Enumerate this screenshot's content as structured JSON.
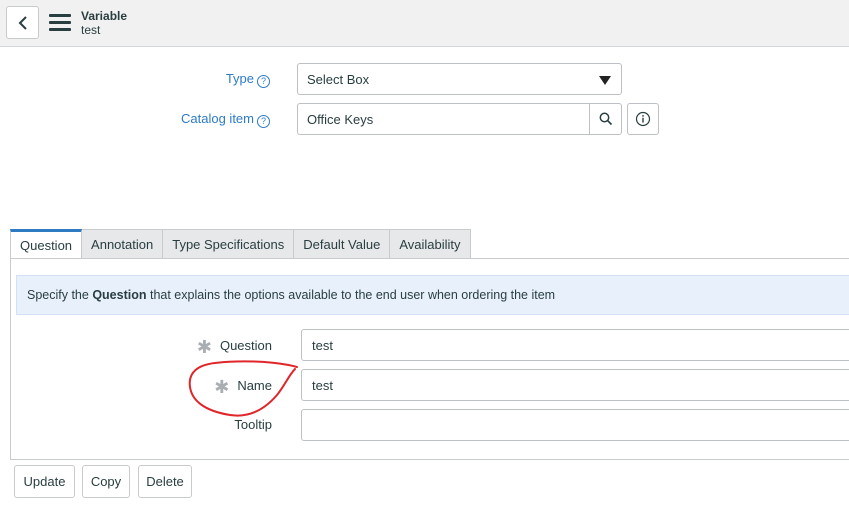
{
  "header": {
    "title": "Variable",
    "subtitle": "test"
  },
  "form": {
    "type": {
      "label": "Type",
      "value": "Select Box"
    },
    "catalog_item": {
      "label": "Catalog item",
      "value": "Office Keys"
    }
  },
  "tabs": [
    {
      "label": "Question",
      "active": true
    },
    {
      "label": "Annotation"
    },
    {
      "label": "Type Specifications"
    },
    {
      "label": "Default Value"
    },
    {
      "label": "Availability"
    }
  ],
  "info": {
    "prefix": "Specify the ",
    "bold": "Question",
    "suffix": " that explains the options available to the end user when ordering the item"
  },
  "fields": {
    "question": {
      "label": "Question",
      "value": "test",
      "mandatory": true
    },
    "name": {
      "label": "Name",
      "value": "test",
      "mandatory": true
    },
    "tooltip": {
      "label": "Tooltip",
      "value": ""
    }
  },
  "buttons": {
    "update": "Update",
    "copy": "Copy",
    "delete": "Delete"
  },
  "colors": {
    "link_blue": "#2e7bc4",
    "annotation_red": "#e0262a",
    "info_bg": "#e8f1fb"
  },
  "icons": [
    "back-icon",
    "hamburger-menu-icon",
    "help-icon",
    "dropdown-caret-icon",
    "search-icon",
    "info-icon",
    "mandatory-star-icon"
  ]
}
